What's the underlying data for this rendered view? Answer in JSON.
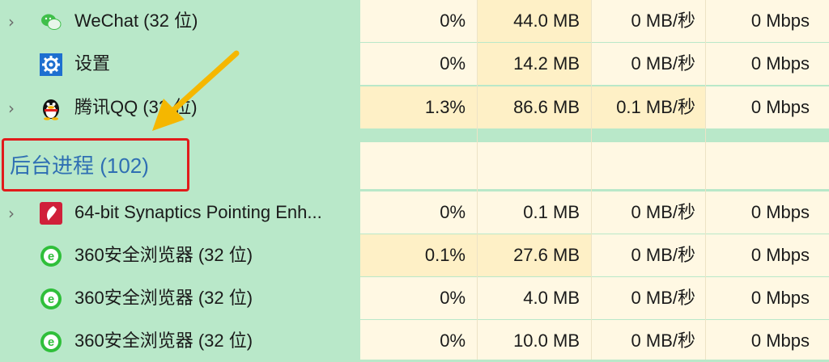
{
  "colors": {
    "background": "#b9e8c9",
    "cell_light": "#fff8e3",
    "cell_medium": "#fef0c6",
    "group_title": "#2f6fb3",
    "highlight_box": "#e11b1b",
    "arrow": "#f5b700"
  },
  "rows": [
    {
      "name": "WeChat (32 位)",
      "icon": "wechat-icon",
      "expandable": true,
      "cpu": "0%",
      "memory": "44.0 MB",
      "disk": "0 MB/秒",
      "network": "0 Mbps"
    },
    {
      "name": "设置",
      "icon": "settings-gear-icon",
      "expandable": false,
      "cpu": "0%",
      "memory": "14.2 MB",
      "disk": "0 MB/秒",
      "network": "0 Mbps"
    },
    {
      "name": "腾讯QQ (32 位)",
      "icon": "qq-penguin-icon",
      "expandable": true,
      "cpu": "1.3%",
      "memory": "86.6 MB",
      "disk": "0.1 MB/秒",
      "network": "0 Mbps"
    }
  ],
  "group": {
    "label": "后台进程 (102)"
  },
  "background_rows": [
    {
      "name": "64-bit Synaptics Pointing Enh...",
      "icon": "synaptics-icon",
      "expandable": true,
      "cpu": "0%",
      "memory": "0.1 MB",
      "disk": "0 MB/秒",
      "network": "0 Mbps"
    },
    {
      "name": "360安全浏览器 (32 位)",
      "icon": "360-browser-icon",
      "expandable": false,
      "cpu": "0.1%",
      "memory": "27.6 MB",
      "disk": "0 MB/秒",
      "network": "0 Mbps"
    },
    {
      "name": "360安全浏览器 (32 位)",
      "icon": "360-browser-icon",
      "expandable": false,
      "cpu": "0%",
      "memory": "4.0 MB",
      "disk": "0 MB/秒",
      "network": "0 Mbps"
    },
    {
      "name": "360安全浏览器 (32 位)",
      "icon": "360-browser-icon",
      "expandable": false,
      "cpu": "0%",
      "memory": "10.0 MB",
      "disk": "0 MB/秒",
      "network": "0 Mbps"
    }
  ]
}
